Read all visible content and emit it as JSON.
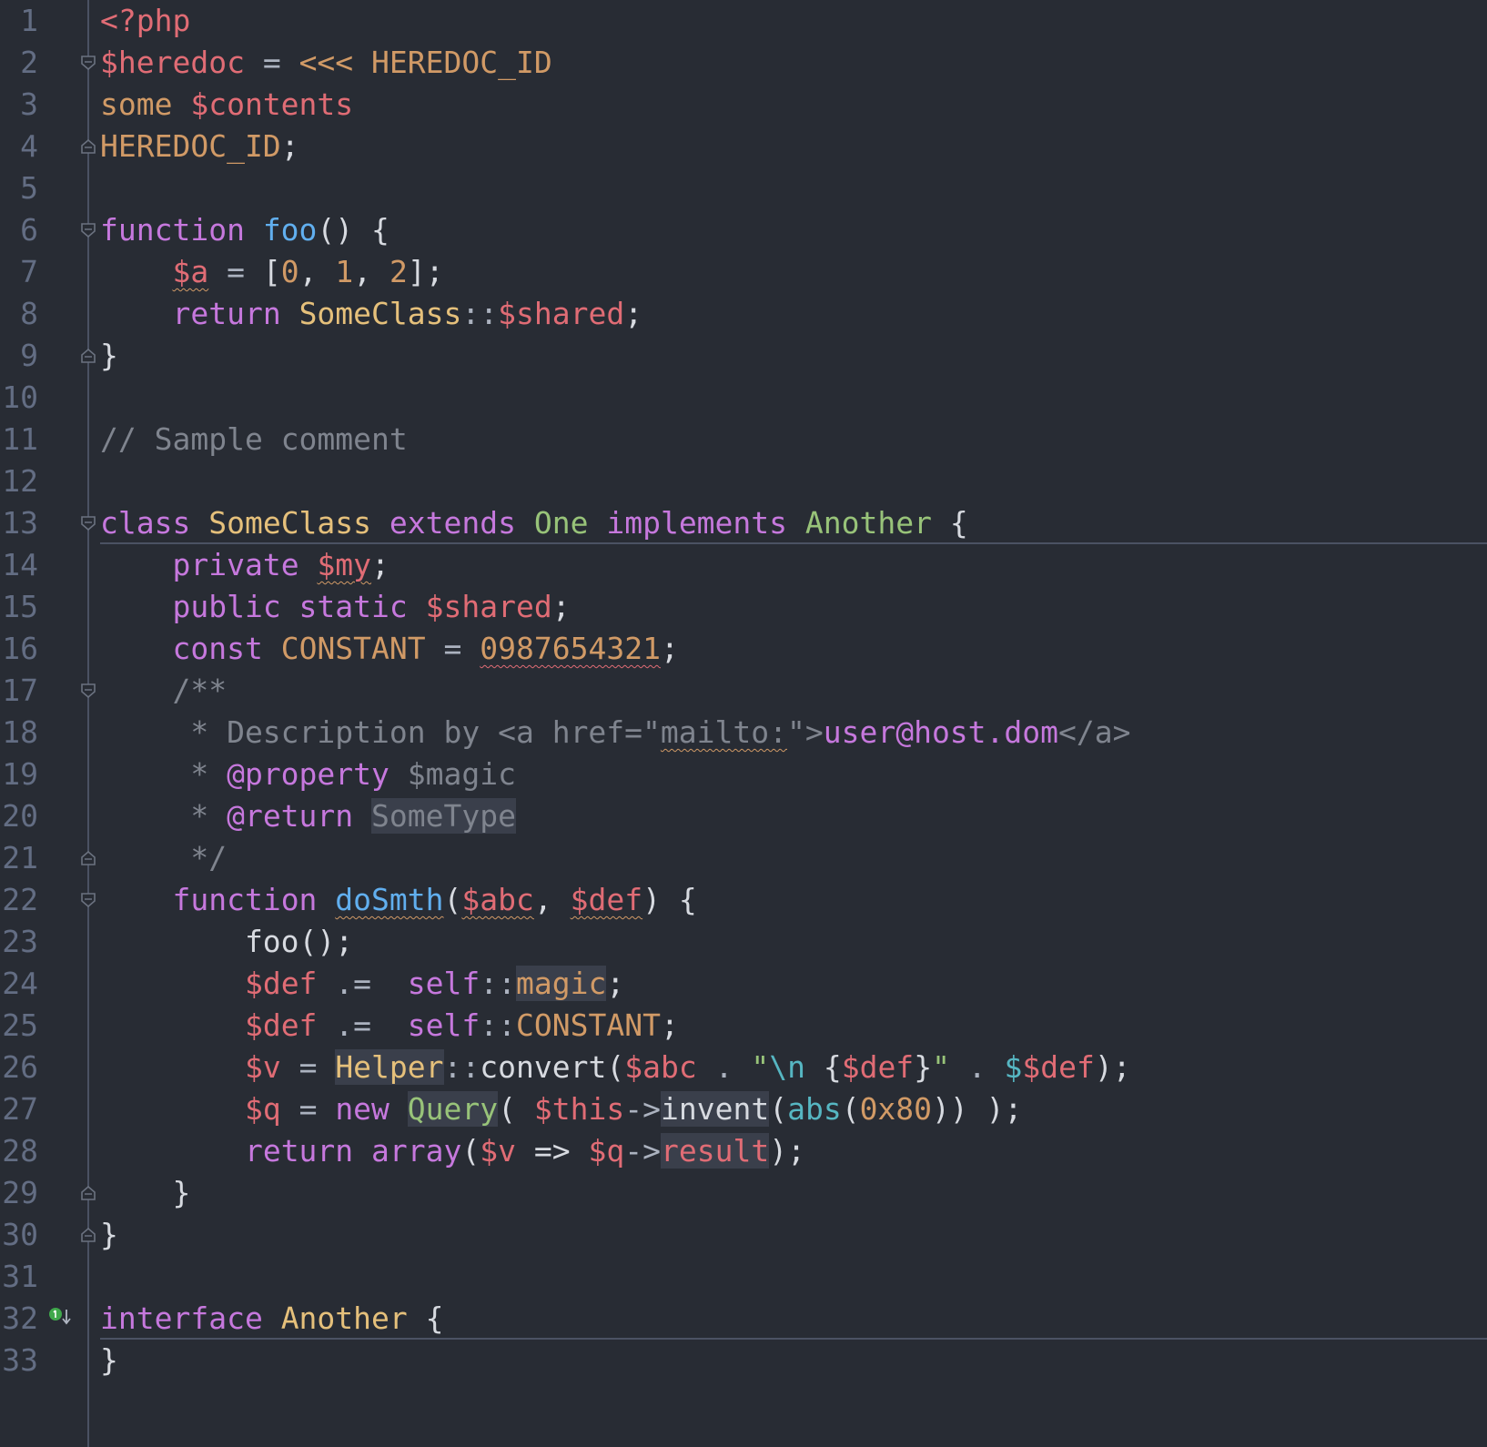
{
  "editor": {
    "language": "PHP",
    "colors": {
      "background": "#282c34",
      "gutter_border": "#4b5263",
      "line_number": "#636d83"
    },
    "line_numbers": [
      "1",
      "2",
      "3",
      "4",
      "5",
      "6",
      "7",
      "8",
      "9",
      "10",
      "11",
      "12",
      "13",
      "14",
      "15",
      "16",
      "17",
      "18",
      "19",
      "20",
      "21",
      "22",
      "23",
      "24",
      "25",
      "26",
      "27",
      "28",
      "29",
      "30",
      "31",
      "32",
      "33"
    ],
    "lines": [
      [
        {
          "t": "<?php",
          "c": "t-var"
        }
      ],
      [
        {
          "t": "$heredoc",
          "c": "t-var"
        },
        {
          "t": " = ",
          "c": "t-op"
        },
        {
          "t": "<<< HEREDOC_ID",
          "c": "t-hd"
        }
      ],
      [
        {
          "t": "some ",
          "c": "t-hd"
        },
        {
          "t": "$contents",
          "c": "t-var"
        }
      ],
      [
        {
          "t": "HEREDOC_ID",
          "c": "t-hd"
        },
        {
          "t": ";",
          "c": "t-plain"
        }
      ],
      [],
      [
        {
          "t": "function ",
          "c": "t-kw"
        },
        {
          "t": "foo",
          "c": "t-fn"
        },
        {
          "t": "() {",
          "c": "t-plain"
        }
      ],
      [
        {
          "t": "    ",
          "c": "t-plain"
        },
        {
          "t": "$a",
          "c": "t-var sq2"
        },
        {
          "t": " = ",
          "c": "t-op"
        },
        {
          "t": "[",
          "c": "t-plain"
        },
        {
          "t": "0",
          "c": "t-num"
        },
        {
          "t": ", ",
          "c": "t-plain"
        },
        {
          "t": "1",
          "c": "t-num"
        },
        {
          "t": ", ",
          "c": "t-plain"
        },
        {
          "t": "2",
          "c": "t-num"
        },
        {
          "t": "];",
          "c": "t-plain"
        }
      ],
      [
        {
          "t": "    ",
          "c": "t-plain"
        },
        {
          "t": "return ",
          "c": "t-kw"
        },
        {
          "t": "SomeClass",
          "c": "t-cls"
        },
        {
          "t": "::",
          "c": "t-op"
        },
        {
          "t": "$shared",
          "c": "t-var"
        },
        {
          "t": ";",
          "c": "t-plain"
        }
      ],
      [
        {
          "t": "}",
          "c": "t-plain"
        }
      ],
      [],
      [
        {
          "t": "// Sample comment",
          "c": "t-cm"
        }
      ],
      [],
      [
        {
          "t": "class ",
          "c": "t-kw"
        },
        {
          "t": "SomeClass ",
          "c": "t-cls"
        },
        {
          "t": "extends ",
          "c": "t-kw"
        },
        {
          "t": "One ",
          "c": "t-cls2"
        },
        {
          "t": "implements ",
          "c": "t-kw"
        },
        {
          "t": "Another ",
          "c": "t-cls2"
        },
        {
          "t": "{",
          "c": "t-plain"
        }
      ],
      [
        {
          "t": "    ",
          "c": "t-plain"
        },
        {
          "t": "private ",
          "c": "t-kw"
        },
        {
          "t": "$my",
          "c": "t-var sq2"
        },
        {
          "t": ";",
          "c": "t-plain"
        }
      ],
      [
        {
          "t": "    ",
          "c": "t-plain"
        },
        {
          "t": "public static ",
          "c": "t-kw"
        },
        {
          "t": "$shared",
          "c": "t-var"
        },
        {
          "t": ";",
          "c": "t-plain"
        }
      ],
      [
        {
          "t": "    ",
          "c": "t-plain"
        },
        {
          "t": "const ",
          "c": "t-kw"
        },
        {
          "t": "CONSTANT",
          "c": "t-num"
        },
        {
          "t": " = ",
          "c": "t-op"
        },
        {
          "t": "0987654321",
          "c": "t-num sq"
        },
        {
          "t": ";",
          "c": "t-plain"
        }
      ],
      [
        {
          "t": "    /**",
          "c": "t-cm"
        }
      ],
      [
        {
          "t": "     * Description by ",
          "c": "t-cm"
        },
        {
          "t": "<a href=\"",
          "c": "t-cm"
        },
        {
          "t": "mailto:",
          "c": "t-cm sq2"
        },
        {
          "t": "\">",
          "c": "t-cm"
        },
        {
          "t": "user@host.dom",
          "c": "t-tag"
        },
        {
          "t": "</a>",
          "c": "t-cm"
        }
      ],
      [
        {
          "t": "     * ",
          "c": "t-cm"
        },
        {
          "t": "@property ",
          "c": "t-kw"
        },
        {
          "t": "$magic",
          "c": "t-cm"
        }
      ],
      [
        {
          "t": "     * ",
          "c": "t-cm"
        },
        {
          "t": "@return ",
          "c": "t-kw"
        },
        {
          "t": "SomeType",
          "c": "t-cm hl"
        }
      ],
      [
        {
          "t": "     */",
          "c": "t-cm"
        }
      ],
      [
        {
          "t": "    ",
          "c": "t-plain"
        },
        {
          "t": "function ",
          "c": "t-kw"
        },
        {
          "t": "doSmth",
          "c": "t-fn sq2"
        },
        {
          "t": "(",
          "c": "t-plain"
        },
        {
          "t": "$abc",
          "c": "t-var sq2"
        },
        {
          "t": ", ",
          "c": "t-plain"
        },
        {
          "t": "$def",
          "c": "t-var sq2"
        },
        {
          "t": ") {",
          "c": "t-plain"
        }
      ],
      [
        {
          "t": "        foo();",
          "c": "t-plain"
        }
      ],
      [
        {
          "t": "        ",
          "c": "t-plain"
        },
        {
          "t": "$def",
          "c": "t-var"
        },
        {
          "t": " .=  ",
          "c": "t-op"
        },
        {
          "t": "self",
          "c": "t-kw"
        },
        {
          "t": "::",
          "c": "t-op"
        },
        {
          "t": "magic",
          "c": "t-num hl"
        },
        {
          "t": ";",
          "c": "t-plain"
        }
      ],
      [
        {
          "t": "        ",
          "c": "t-plain"
        },
        {
          "t": "$def",
          "c": "t-var"
        },
        {
          "t": " .=  ",
          "c": "t-op"
        },
        {
          "t": "self",
          "c": "t-kw"
        },
        {
          "t": "::",
          "c": "t-op"
        },
        {
          "t": "CONSTANT",
          "c": "t-num"
        },
        {
          "t": ";",
          "c": "t-plain"
        }
      ],
      [
        {
          "t": "        ",
          "c": "t-plain"
        },
        {
          "t": "$v",
          "c": "t-var"
        },
        {
          "t": " = ",
          "c": "t-op"
        },
        {
          "t": "Helper",
          "c": "t-cls hl"
        },
        {
          "t": "::",
          "c": "t-op"
        },
        {
          "t": "convert(",
          "c": "t-plain"
        },
        {
          "t": "$abc",
          "c": "t-var"
        },
        {
          "t": " . ",
          "c": "t-op"
        },
        {
          "t": "\"",
          "c": "t-str"
        },
        {
          "t": "\\n",
          "c": "t-esc"
        },
        {
          "t": " {",
          "c": "t-plain"
        },
        {
          "t": "$def",
          "c": "t-var"
        },
        {
          "t": "}",
          "c": "t-plain"
        },
        {
          "t": "\"",
          "c": "t-str"
        },
        {
          "t": " . ",
          "c": "t-op"
        },
        {
          "t": "$",
          "c": "t-esc"
        },
        {
          "t": "$def",
          "c": "t-var"
        },
        {
          "t": ");",
          "c": "t-plain"
        }
      ],
      [
        {
          "t": "        ",
          "c": "t-plain"
        },
        {
          "t": "$q",
          "c": "t-var"
        },
        {
          "t": " = ",
          "c": "t-op"
        },
        {
          "t": "new ",
          "c": "t-kw"
        },
        {
          "t": "Query",
          "c": "t-cls2 hl"
        },
        {
          "t": "( ",
          "c": "t-plain"
        },
        {
          "t": "$this",
          "c": "t-var"
        },
        {
          "t": "->",
          "c": "t-op"
        },
        {
          "t": "invent",
          "c": "t-plain hl"
        },
        {
          "t": "(",
          "c": "t-plain"
        },
        {
          "t": "abs",
          "c": "t-bf"
        },
        {
          "t": "(",
          "c": "t-plain"
        },
        {
          "t": "0x80",
          "c": "t-num"
        },
        {
          "t": ")) );",
          "c": "t-plain"
        }
      ],
      [
        {
          "t": "        ",
          "c": "t-plain"
        },
        {
          "t": "return ",
          "c": "t-kw"
        },
        {
          "t": "array",
          "c": "t-kw"
        },
        {
          "t": "(",
          "c": "t-plain"
        },
        {
          "t": "$v",
          "c": "t-var"
        },
        {
          "t": " => ",
          "c": "t-plain"
        },
        {
          "t": "$q",
          "c": "t-var"
        },
        {
          "t": "->",
          "c": "t-op"
        },
        {
          "t": "result",
          "c": "t-var hl"
        },
        {
          "t": ");",
          "c": "t-plain"
        }
      ],
      [
        {
          "t": "    }",
          "c": "t-plain"
        }
      ],
      [
        {
          "t": "}",
          "c": "t-plain"
        }
      ],
      [],
      [
        {
          "t": "interface ",
          "c": "t-kw"
        },
        {
          "t": "Another ",
          "c": "t-cls"
        },
        {
          "t": "{",
          "c": "t-plain"
        }
      ],
      [
        {
          "t": "}",
          "c": "t-plain"
        }
      ]
    ],
    "fold_markers": [
      {
        "line": 2,
        "kind": "open"
      },
      {
        "line": 4,
        "kind": "close"
      },
      {
        "line": 6,
        "kind": "open"
      },
      {
        "line": 9,
        "kind": "close"
      },
      {
        "line": 13,
        "kind": "open"
      },
      {
        "line": 17,
        "kind": "open"
      },
      {
        "line": 21,
        "kind": "close"
      },
      {
        "line": 22,
        "kind": "open"
      },
      {
        "line": 29,
        "kind": "close"
      },
      {
        "line": 30,
        "kind": "close"
      }
    ],
    "separators_after_lines": [
      12,
      31
    ],
    "implemented_marker_line": 32
  }
}
